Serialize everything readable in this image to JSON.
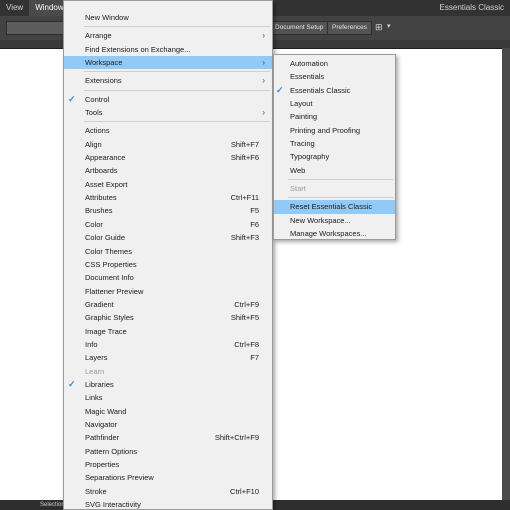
{
  "menubar": {
    "items": [
      "View",
      "Window"
    ],
    "workspace": "Essentials Classic"
  },
  "controlbar": {
    "document_setup": "Document Setup",
    "preferences": "Preferences"
  },
  "statusbar": {
    "text": "Selection"
  },
  "window_menu": {
    "new_window": "New Window",
    "arrange": "Arrange",
    "find_extensions": "Find Extensions on Exchange...",
    "workspace": "Workspace",
    "extensions": "Extensions",
    "control": "Control",
    "tools": "Tools",
    "panels": [
      {
        "label": "Actions",
        "shortcut": ""
      },
      {
        "label": "Align",
        "shortcut": "Shift+F7"
      },
      {
        "label": "Appearance",
        "shortcut": "Shift+F6"
      },
      {
        "label": "Artboards",
        "shortcut": ""
      },
      {
        "label": "Asset Export",
        "shortcut": ""
      },
      {
        "label": "Attributes",
        "shortcut": "Ctrl+F11"
      },
      {
        "label": "Brushes",
        "shortcut": "F5"
      },
      {
        "label": "Color",
        "shortcut": "F6"
      },
      {
        "label": "Color Guide",
        "shortcut": "Shift+F3"
      },
      {
        "label": "Color Themes",
        "shortcut": ""
      },
      {
        "label": "CSS Properties",
        "shortcut": ""
      },
      {
        "label": "Document Info",
        "shortcut": ""
      },
      {
        "label": "Flattener Preview",
        "shortcut": ""
      },
      {
        "label": "Gradient",
        "shortcut": "Ctrl+F9"
      },
      {
        "label": "Graphic Styles",
        "shortcut": "Shift+F5"
      },
      {
        "label": "Image Trace",
        "shortcut": ""
      },
      {
        "label": "Info",
        "shortcut": "Ctrl+F8"
      },
      {
        "label": "Layers",
        "shortcut": "F7"
      },
      {
        "label": "Learn",
        "shortcut": ""
      },
      {
        "label": "Libraries",
        "shortcut": ""
      },
      {
        "label": "Links",
        "shortcut": ""
      },
      {
        "label": "Magic Wand",
        "shortcut": ""
      },
      {
        "label": "Navigator",
        "shortcut": ""
      },
      {
        "label": "Pathfinder",
        "shortcut": "Shift+Ctrl+F9"
      },
      {
        "label": "Pattern Options",
        "shortcut": ""
      },
      {
        "label": "Properties",
        "shortcut": ""
      },
      {
        "label": "Separations Preview",
        "shortcut": ""
      },
      {
        "label": "Stroke",
        "shortcut": "Ctrl+F10"
      },
      {
        "label": "SVG Interactivity",
        "shortcut": ""
      }
    ]
  },
  "workspace_menu": {
    "automation": "Automation",
    "essentials": "Essentials",
    "essentials_classic": "Essentials Classic",
    "layout": "Layout",
    "painting": "Painting",
    "printing_proofing": "Printing and Proofing",
    "tracing": "Tracing",
    "typography": "Typography",
    "web": "Web",
    "start": "Start",
    "reset": "Reset Essentials Classic",
    "new_workspace": "New Workspace...",
    "manage_workspaces": "Manage Workspaces..."
  },
  "colors": {
    "highlight": "#91c9f7",
    "check": "#3c8bd9",
    "menu_bg": "#f0f0f0"
  }
}
